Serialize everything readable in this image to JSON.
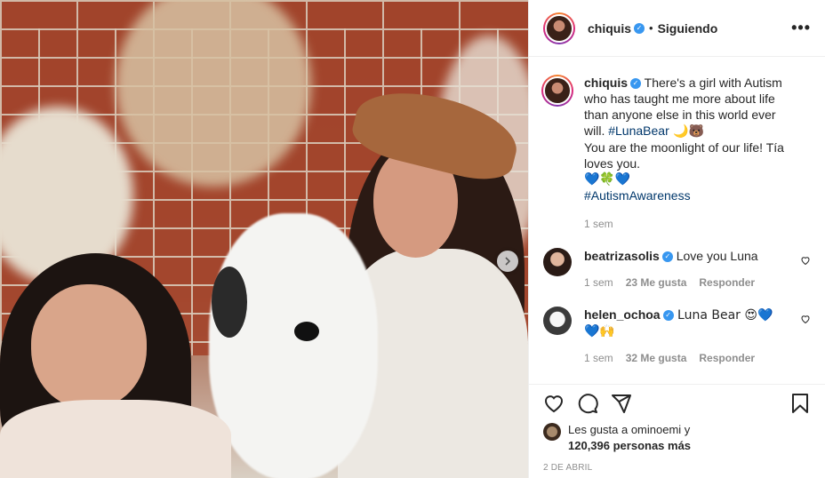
{
  "post": {
    "username": "chiquis",
    "dot": "•",
    "following": "Siguiendo",
    "more": "•••"
  },
  "caption": {
    "username": "chiquis",
    "text_1": " There's a girl with Autism who has taught me more about life than anyone else in this world ever will. ",
    "hashtag_1": "#LunaBear",
    "emojis_1": " 🌙🐻",
    "text_2": "You are the moonlight of our life! Tía loves you.",
    "emojis_2": "💙🍀💙",
    "hashtag_2": "#AutismAwareness",
    "time": "1 sem"
  },
  "comments": [
    {
      "username": "beatrizasolis",
      "text": " Love you Luna",
      "time": "1 sem",
      "likes": "23 Me gusta",
      "reply": "Responder"
    },
    {
      "username": "helen_ochoa",
      "text": " Luna Bear 😍💙",
      "text_2": "💙🙌",
      "time": "1 sem",
      "likes": "32 Me gusta",
      "reply": "Responder"
    }
  ],
  "likes": {
    "prefix": "Les gusta a ",
    "user": "ominoemi",
    "suffix": " y",
    "count": "120,396 personas más"
  },
  "date": "2 DE ABRIL",
  "colors": {
    "link": "#00376b",
    "verified": "#3897f0",
    "muted": "#8e8e8e"
  },
  "icons": [
    "verified-icon",
    "more-icon",
    "heart-icon",
    "comment-icon",
    "share-icon",
    "bookmark-icon",
    "next-arrow-icon"
  ]
}
